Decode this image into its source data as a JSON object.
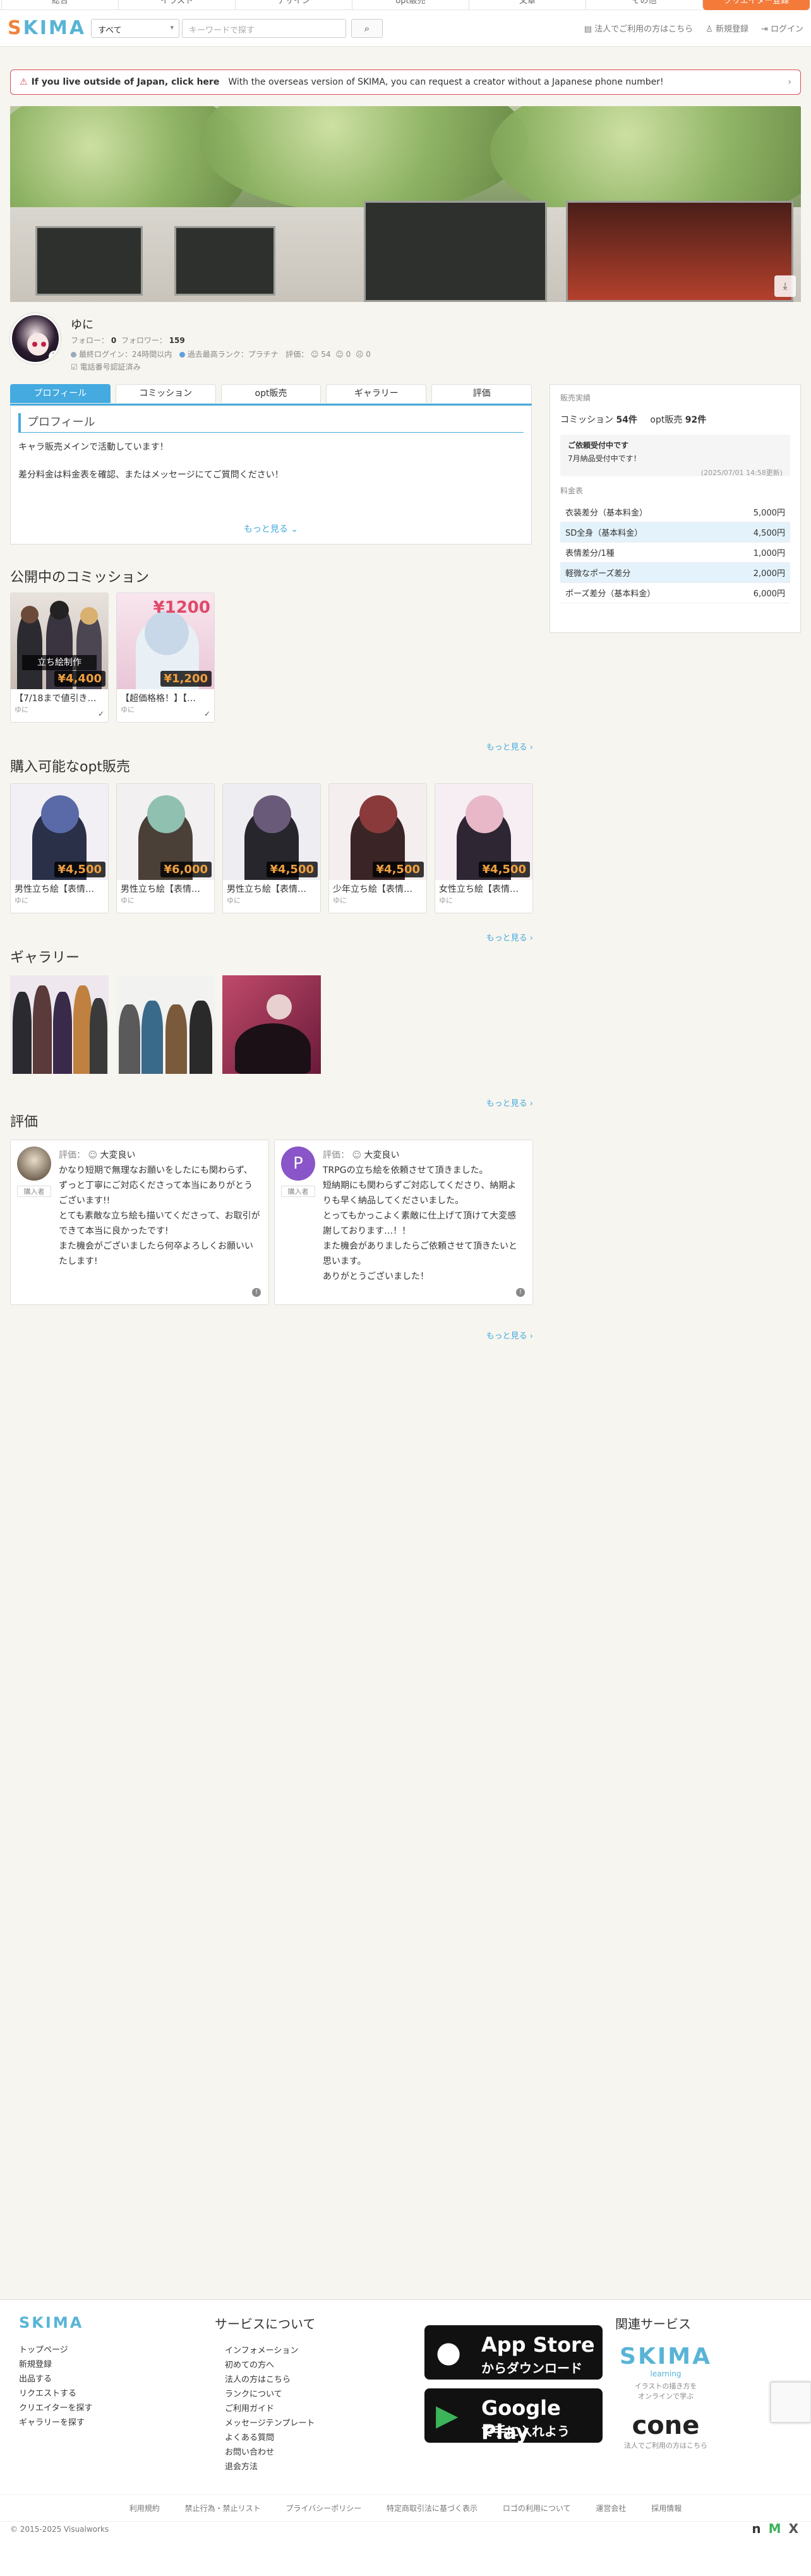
{
  "topnav": [
    "総合",
    "イラスト",
    "デザイン",
    "opt販売",
    "文章",
    "その他",
    "クリエイター登録"
  ],
  "header": {
    "logo": "SKIMA",
    "search_select": "すべて",
    "search_placeholder": "キーワードで探す",
    "corp_link": "法人でご利用の方はこちら",
    "signup": "新規登録",
    "login": "ログイン"
  },
  "notice": {
    "bold": "If you live outside of Japan, click here",
    "text": "With the overseas version of SKIMA, you can request a creator without a Japanese phone number!"
  },
  "profile": {
    "name": "ゆに",
    "follow_label": "フォロー",
    "follow_count": "0",
    "follower_label": "フォロワー",
    "follower_count": "159",
    "last_login": "最終ログイン：24時間以内",
    "rank": "過去最高ランク：プラチナ",
    "rating_label": "評価：",
    "rating_good": "54",
    "rating_normal": "0",
    "rating_bad": "0",
    "phone": "電話番号認証済み"
  },
  "tabs": [
    "プロフィール",
    "コミッション",
    "opt販売",
    "ギャラリー",
    "評価"
  ],
  "profile_box": {
    "heading": "プロフィール",
    "lines": [
      "キャラ販売メインで活動しています！",
      "差分料金は料金表を確認、またはメッセージにてご質問ください！"
    ],
    "more": "もっと見る"
  },
  "side": {
    "label_record": "販売実績",
    "commission_label": "コミッション",
    "commission_count": "54件",
    "opt_label": "opt販売",
    "opt_count": "92件",
    "status_title": "ご依頼受付中です",
    "status_sub": "7月納品受付中です！",
    "status_date": "(2025/07/01 14:58更新)",
    "price_label": "料金表",
    "prices": [
      {
        "name": "衣装差分（基本料金）",
        "price": "5,000円"
      },
      {
        "name": "SD全身（基本料金）",
        "price": "4,500円"
      },
      {
        "name": "表情差分/1種",
        "price": "1,000円"
      },
      {
        "name": "軽微なポーズ差分",
        "price": "2,000円"
      },
      {
        "name": "ポーズ差分（基本料金）",
        "price": "6,000円"
      }
    ]
  },
  "commission": {
    "heading": "公開中のコミッション",
    "items": [
      {
        "title": "【7/18まで値引き…",
        "user": "ゆに",
        "price": "¥4,400",
        "overlay": "立ち絵制作"
      },
      {
        "title": "【超価格格！】【…",
        "user": "ゆに",
        "price": "¥1,200",
        "overlay": "¥1200"
      }
    ],
    "more": "もっと見る"
  },
  "opt": {
    "heading": "購入可能なopt販売",
    "items": [
      {
        "title": "男性立ち絵【表情…",
        "user": "ゆに",
        "price": "¥4,500"
      },
      {
        "title": "男性立ち絵【表情…",
        "user": "ゆに",
        "price": "¥6,000"
      },
      {
        "title": "男性立ち絵【表情…",
        "user": "ゆに",
        "price": "¥4,500"
      },
      {
        "title": "少年立ち絵【表情…",
        "user": "ゆに",
        "price": "¥4,500"
      },
      {
        "title": "女性立ち絵【表情…",
        "user": "ゆに",
        "price": "¥4,500"
      }
    ],
    "more": "もっと見る"
  },
  "gallery": {
    "heading": "ギャラリー",
    "more": "もっと見る"
  },
  "reviews": {
    "heading": "評価",
    "items": [
      {
        "rating_label": "評価：",
        "rating": "大変良い",
        "buyer": "購入者",
        "text": "かなり短期で無理なお願いをしたにも関わらず、ずっと丁寧にご対応くださって本当にありがとうございます!!\nとても素敵な立ち絵も描いてくださって、お取引ができて本当に良かったです!\nまた機会がございましたら何卒よろしくお願いいたします!"
      },
      {
        "rating_label": "評価：",
        "rating": "大変良い",
        "buyer": "購入者",
        "avatar_letter": "P",
        "text": "TRPGの立ち絵を依頼させて頂きました。\n短納期にも関わらずご対応してくださり、納期よりも早く納品してくださいました。\nとってもかっこよく素敵に仕上げて頂けて大変感謝しております…！！\nまた機会がありましたらご依頼させて頂きたいと思います。\nありがとうございました！"
      }
    ],
    "more": "もっと見る"
  },
  "footer": {
    "logo": "SKIMA",
    "links1": [
      "トップページ",
      "新規登録",
      "出品する",
      "リクエストする",
      "クリエイターを探す",
      "ギャラリーを探す"
    ],
    "service_title": "サービスについて",
    "links2": [
      "インフォメーション",
      "初めての方へ",
      "法人の方はこちら",
      "ランクについて",
      "ご利用ガイド",
      "メッセージテンプレート",
      "よくある質問",
      "お問い合わせ",
      "退会方法"
    ],
    "appstore_1": "App Store",
    "appstore_2": "からダウンロード",
    "gplay_1": "Google Play",
    "gplay_2": "で手に入れよう",
    "related_title": "関連サービス",
    "skima_learning": "SKIMA",
    "skima_learning_sub": "learning",
    "skima_learning_desc": "イラストの描き方を\nオンラインで学ぶ",
    "cone": "cone",
    "cone_desc": "法人でご利用の方はこちら",
    "bottom_links": [
      "利用規約",
      "禁止行為・禁止リスト",
      "プライバシーポリシー",
      "特定商取引法に基づく表示",
      "ロゴの利用について",
      "運営会社",
      "採用情報"
    ],
    "copyright": "© 2015-2025 Visualworks"
  }
}
